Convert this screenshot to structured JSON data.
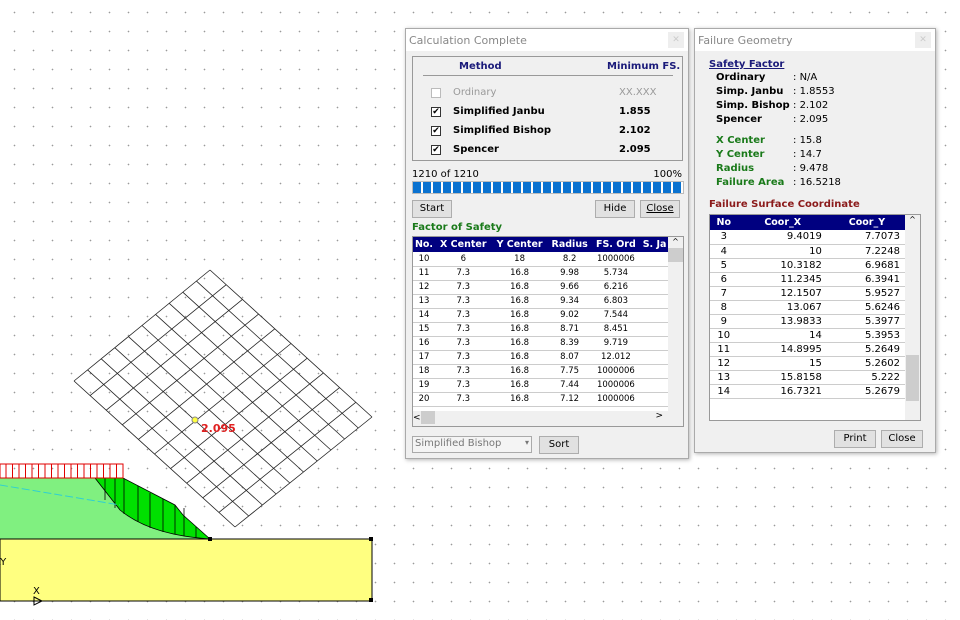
{
  "drawing": {
    "grid_fs_label": "2.095",
    "axis_y_label": "Y",
    "axis_x_label": "X",
    "partial_label": "AY"
  },
  "colors": {
    "soil_upper": "#80f080",
    "soil_lower": "#ffff80",
    "failure_zone": "#00e000",
    "load": "#e00000",
    "water_table": "#40e0e0",
    "fs_label": "#e02020"
  },
  "calc": {
    "title": "Calculation Complete",
    "method_header": "Method",
    "fs_header": "Minimum FS.",
    "methods": [
      {
        "label": "Ordinary",
        "value": "XX.XXX",
        "checked": false,
        "enabled": false
      },
      {
        "label": "Simplified Janbu",
        "value": "1.855",
        "checked": true,
        "enabled": true
      },
      {
        "label": "Simplified Bishop",
        "value": "2.102",
        "checked": true,
        "enabled": true
      },
      {
        "label": "Spencer",
        "value": "2.095",
        "checked": true,
        "enabled": true
      }
    ],
    "progress_text": "1210 of 1210",
    "progress_percent_text": "100%",
    "progress": 1.0,
    "start": "Start",
    "hide": "Hide",
    "close": "Close",
    "fos_title": "Factor of Safety",
    "columns": [
      "No.",
      "X Center",
      "Y Center",
      "Radius",
      "FS. Ord",
      "S. Ja"
    ],
    "rows": [
      [
        "10",
        "6",
        "18",
        "8.2",
        "1000006"
      ],
      [
        "11",
        "7.3",
        "16.8",
        "9.98",
        "5.734"
      ],
      [
        "12",
        "7.3",
        "16.8",
        "9.66",
        "6.216"
      ],
      [
        "13",
        "7.3",
        "16.8",
        "9.34",
        "6.803"
      ],
      [
        "14",
        "7.3",
        "16.8",
        "9.02",
        "7.544"
      ],
      [
        "15",
        "7.3",
        "16.8",
        "8.71",
        "8.451"
      ],
      [
        "16",
        "7.3",
        "16.8",
        "8.39",
        "9.719"
      ],
      [
        "17",
        "7.3",
        "16.8",
        "8.07",
        "12.012"
      ],
      [
        "18",
        "7.3",
        "16.8",
        "7.75",
        "1000006"
      ],
      [
        "19",
        "7.3",
        "16.8",
        "7.44",
        "1000006"
      ],
      [
        "20",
        "7.3",
        "16.8",
        "7.12",
        "1000006"
      ]
    ],
    "sort_select": "Simplified Bishop",
    "sort": "Sort"
  },
  "geom": {
    "title": "Failure Geometry",
    "sf_title": "Safety Factor",
    "sf": [
      {
        "label": "Ordinary",
        "value": "N/A"
      },
      {
        "label": "Simp. Janbu",
        "value": "1.8553"
      },
      {
        "label": "Simp. Bishop",
        "value": "2.102"
      },
      {
        "label": "Spencer",
        "value": "2.095"
      }
    ],
    "circle": [
      {
        "label": "X Center",
        "value": "15.8"
      },
      {
        "label": "Y Center",
        "value": "14.7"
      },
      {
        "label": "Radius",
        "value": "9.478"
      },
      {
        "label": "Failure Area",
        "value": "16.5218"
      }
    ],
    "coord_title": "Failure Surface Coordinate",
    "columns": [
      "No",
      "Coor_X",
      "Coor_Y"
    ],
    "rows": [
      [
        "3",
        "9.4019",
        "7.7073"
      ],
      [
        "4",
        "10",
        "7.2248"
      ],
      [
        "5",
        "10.3182",
        "6.9681"
      ],
      [
        "6",
        "11.2345",
        "6.3941"
      ],
      [
        "7",
        "12.1507",
        "5.9527"
      ],
      [
        "8",
        "13.067",
        "5.6246"
      ],
      [
        "9",
        "13.9833",
        "5.3977"
      ],
      [
        "10",
        "14",
        "5.3953"
      ],
      [
        "11",
        "14.8995",
        "5.2649"
      ],
      [
        "12",
        "15",
        "5.2602"
      ],
      [
        "13",
        "15.8158",
        "5.222"
      ],
      [
        "14",
        "16.7321",
        "5.2679"
      ]
    ],
    "print": "Print",
    "close": "Close"
  }
}
